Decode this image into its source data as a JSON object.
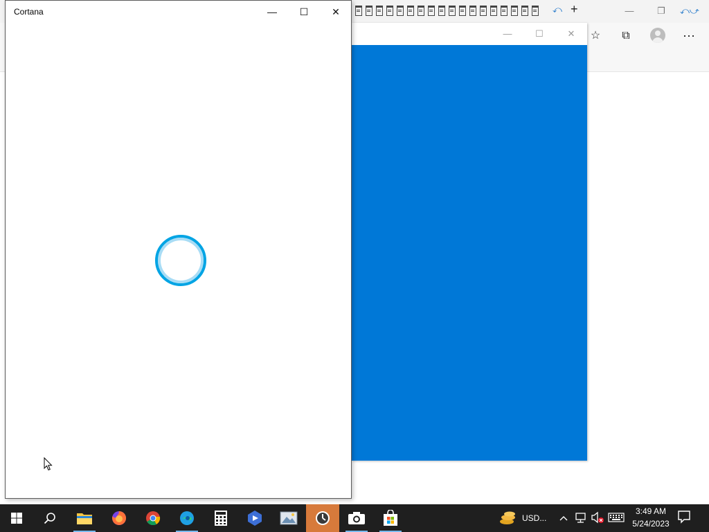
{
  "cortana": {
    "title": "Cortana",
    "minimize": "—",
    "maximize": "☐",
    "close": "✕"
  },
  "blue_window": {
    "minimize": "—",
    "maximize": "☐",
    "close": "✕"
  },
  "browser": {
    "tab_icon_count": 18,
    "minimize": "—",
    "restore": "❐",
    "new_tab": "+",
    "favorites_icon": "☆",
    "collections_icon": "⧉",
    "more_icon": "⋯"
  },
  "taskbar": {
    "tray_weather": "USD...",
    "clock_time": "3:49 AM",
    "clock_date": "5/24/2023"
  },
  "colors": {
    "accent_blue": "#0078d7",
    "cortana_ring": "#00a4e4",
    "taskbar": "#1f1f1f",
    "active_app": "#d77a3b"
  }
}
